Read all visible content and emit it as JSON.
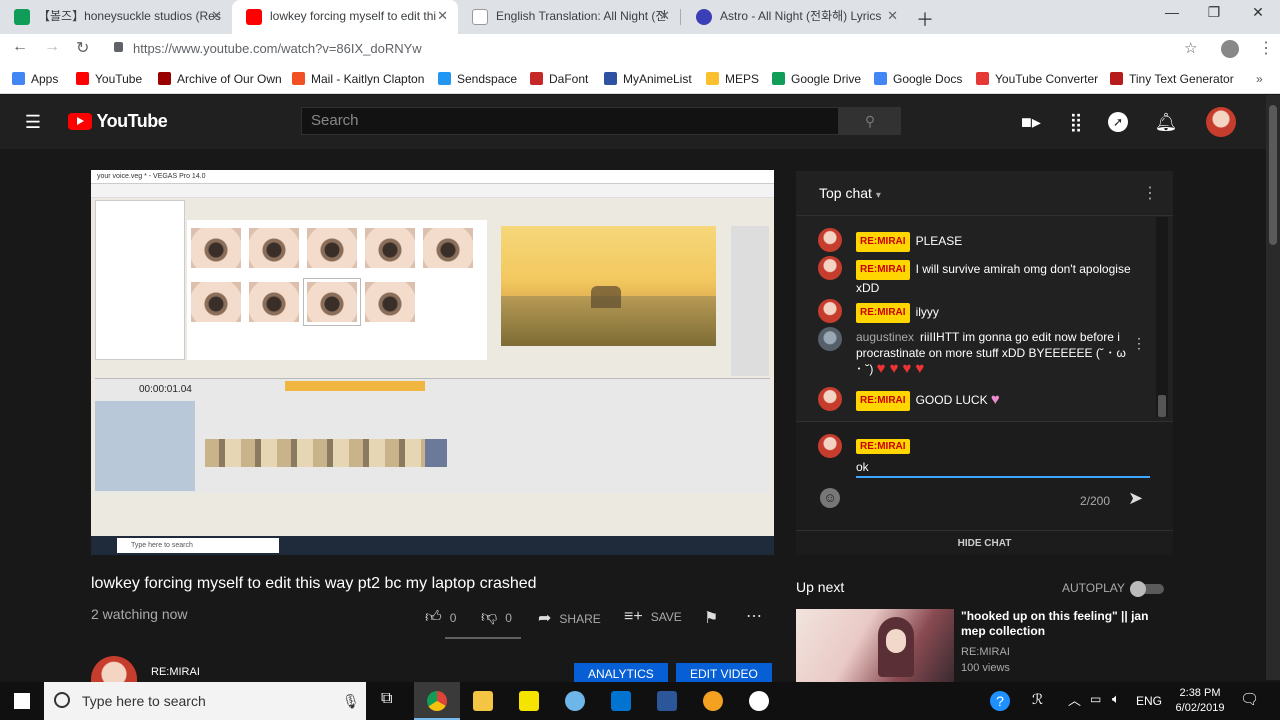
{
  "browser": {
    "tabs": [
      {
        "title": "【볼즈】honeysuckle studios (Res",
        "favicon_color": "#0f9d58"
      },
      {
        "title": "lowkey forcing myself to edit thi",
        "favicon_color": "#ff0000"
      },
      {
        "title": "English Translation: All Night (전",
        "favicon_color": "#888888"
      },
      {
        "title": "Astro - All Night (전화해) Lyrics",
        "favicon_color": "#3b3fb6"
      }
    ],
    "url": "https://www.youtube.com/watch?v=86IX_doRNYw",
    "bookmarks": [
      {
        "label": "Apps",
        "color": "#4285f4"
      },
      {
        "label": "YouTube",
        "color": "#ff0000"
      },
      {
        "label": "Archive of Our Own",
        "color": "#990000"
      },
      {
        "label": "Mail - Kaitlyn Clapton",
        "color": "#f25022"
      },
      {
        "label": "Sendspace",
        "color": "#2196f3"
      },
      {
        "label": "DaFont",
        "color": "#c62828"
      },
      {
        "label": "MyAnimeList",
        "color": "#2e51a2"
      },
      {
        "label": "MEPS",
        "color": "#fbc02d"
      },
      {
        "label": "Google Drive",
        "color": "#0f9d58"
      },
      {
        "label": "Google Docs",
        "color": "#4285f4"
      },
      {
        "label": "YouTube Converter",
        "color": "#e53935"
      },
      {
        "label": "Tiny Text Generator",
        "color": "#b71c1c"
      }
    ]
  },
  "youtube": {
    "logo": "YouTube",
    "search_placeholder": "Search",
    "video": {
      "title": "lowkey forcing myself to edit this way pt2 bc my laptop crashed",
      "status": "2 watching now",
      "likes": "0",
      "dislikes": "0",
      "share_label": "SHARE",
      "save_label": "SAVE",
      "channel": "RE:MIRAI",
      "analytics_label": "ANALYTICS",
      "edit_label": "EDIT VIDEO",
      "inner_app_title": "your voice.veg * - VEGAS Pro 14.0",
      "inner_time": "00:00:01.04",
      "inner_search": "Type here to search"
    },
    "chat": {
      "title": "Top chat",
      "messages": [
        {
          "badge": "RE:MIRAI",
          "author": "",
          "text": "PLEASE"
        },
        {
          "badge": "RE:MIRAI",
          "author": "",
          "text": "I will survive amirah omg don't apologise xDD"
        },
        {
          "badge": "RE:MIRAI",
          "author": "",
          "text": "ilyyy"
        },
        {
          "badge": "",
          "author": "augustinex",
          "text": "riiIIHTT im gonna go edit now before i procrastinate on more stuff xDD BYEEEEEE (˘ ･ ω ･ ˘)",
          "hearts": "♥♥♥♥"
        },
        {
          "badge": "RE:MIRAI",
          "author": "",
          "text": "GOOD LUCK",
          "hearts": "♥"
        }
      ],
      "input_badge": "RE:MIRAI",
      "input_value": "ok",
      "char_count": "2/200",
      "hide_label": "HIDE CHAT"
    },
    "up_next": {
      "title": "Up next",
      "autoplay_label": "AUTOPLAY",
      "item_title": "\"hooked up on this feeling\" || jan mep collection",
      "item_channel": "RE:MIRAI",
      "item_views": "100 views"
    }
  },
  "taskbar": {
    "search_placeholder": "Type here to search",
    "language": "ENG",
    "time": "2:38 PM",
    "date": "6/02/2019"
  }
}
